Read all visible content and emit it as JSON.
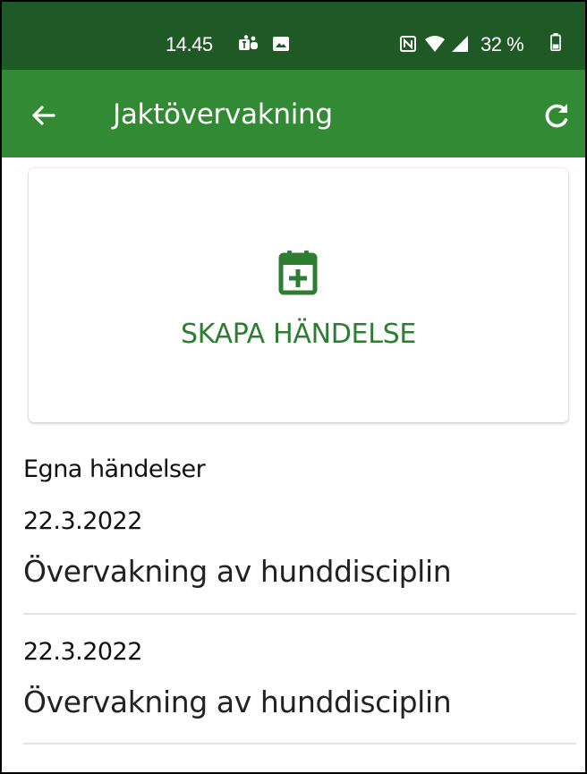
{
  "status_bar": {
    "time": "14.45",
    "battery": "32 %",
    "icons": [
      "teams-icon",
      "image-icon",
      "nfc-icon",
      "wifi-icon",
      "signal-icon",
      "battery-icon"
    ]
  },
  "app_bar": {
    "title": "Jaktövervakning",
    "back_icon": "arrow-back-icon",
    "refresh_icon": "refresh-icon"
  },
  "create_card": {
    "label": "SKAPA HÄNDELSE",
    "icon": "calendar-plus-icon"
  },
  "section": {
    "title": "Egna händelser"
  },
  "events": [
    {
      "date": "22.3.2022",
      "name": "Övervakning av hunddisciplin"
    },
    {
      "date": "22.3.2022",
      "name": "Övervakning av hunddisciplin"
    }
  ],
  "colors": {
    "status_bar": "#1f5a26",
    "app_bar": "#338a35",
    "accent": "#2e7d32"
  }
}
